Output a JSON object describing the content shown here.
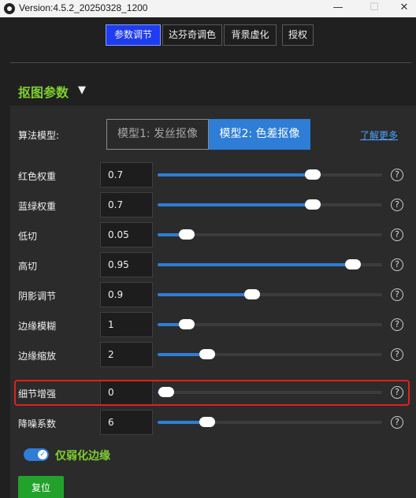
{
  "window": {
    "title": "Version:4.5.2_20250328_1200",
    "min_glyph": "—",
    "max_glyph": "☐",
    "close_glyph": "✕"
  },
  "tabs": [
    {
      "label": "参数调节",
      "active": true
    },
    {
      "label": "达芬奇调色",
      "active": false
    },
    {
      "label": "背景虚化",
      "active": false
    },
    {
      "label": "授权",
      "active": false
    }
  ],
  "section": {
    "title": "抠图参数",
    "arrow": "▼"
  },
  "algorithm": {
    "label": "算法模型:",
    "options": [
      "模型1: 发丝抠像",
      "模型2: 色差抠像"
    ],
    "selected": "模型2: 色差抠像",
    "learn_more": "了解更多"
  },
  "params": [
    {
      "label": "红色权重",
      "value": "0.7",
      "fraction": 0.69
    },
    {
      "label": "蓝绿权重",
      "value": "0.7",
      "fraction": 0.69
    },
    {
      "label": "低切",
      "value": "0.05",
      "fraction": 0.13
    },
    {
      "label": "高切",
      "value": "0.95",
      "fraction": 0.87
    },
    {
      "label": "阴影调节",
      "value": "0.9",
      "fraction": 0.42
    },
    {
      "label": "边缘模糊",
      "value": "1",
      "fraction": 0.13
    },
    {
      "label": "边缘缩放",
      "value": "2",
      "fraction": 0.22
    },
    {
      "label": "细节增强",
      "value": "0",
      "fraction": 0.04
    },
    {
      "label": "降噪系数",
      "value": "6",
      "fraction": 0.22
    }
  ],
  "help_glyph": "?",
  "highlighted_param": "细节增强",
  "toggle": {
    "label": "仅弱化边缘",
    "on": true,
    "check": "✓"
  },
  "reset": {
    "label": "复位"
  },
  "colors": {
    "accent": "#2e7dd6",
    "green_text": "#7fcf2f",
    "active_tab": "#1e3cf0",
    "highlight": "#e02020",
    "reset_btn": "#22a22a"
  }
}
